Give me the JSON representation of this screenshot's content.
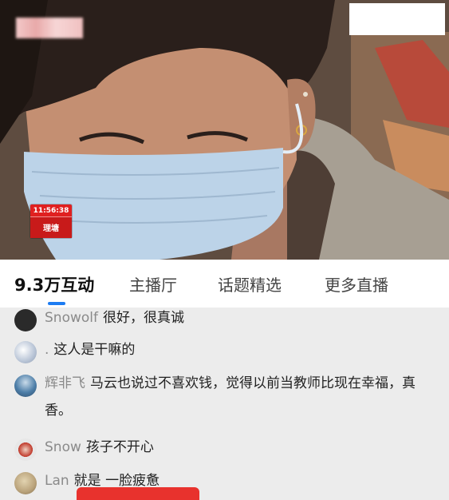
{
  "video": {
    "timestamp": "11:56:38",
    "location": "理塘"
  },
  "tabs": [
    {
      "label": "9.3万互动",
      "active": true
    },
    {
      "label": "主播厅",
      "active": false
    },
    {
      "label": "话题精选",
      "active": false
    },
    {
      "label": "更多直播",
      "active": false
    }
  ],
  "comments": [
    {
      "user": "Snowolf",
      "text": "很好，很真诚",
      "avatar_color": "#2a2a2a"
    },
    {
      "user": ".",
      "text": "这人是干嘛的",
      "avatar_color": "#b8c4d6"
    },
    {
      "user": "辉非飞",
      "text": "马云也说过不喜欢钱，觉得以前当教师比现在幸福，真香。",
      "avatar_color": "#4d7ea8"
    },
    {
      "user": "Snow",
      "text": "孩子不开心",
      "avatar_color": "#c0392b"
    },
    {
      "user": "Lan",
      "text": "就是 一脸疲惫",
      "avatar_color": "#b9a27a"
    }
  ],
  "colors": {
    "live_red": "#e02020",
    "tab_indicator": "#1d7cf2",
    "username_gray": "#8a8a8a",
    "comment_bg": "#ececec"
  }
}
